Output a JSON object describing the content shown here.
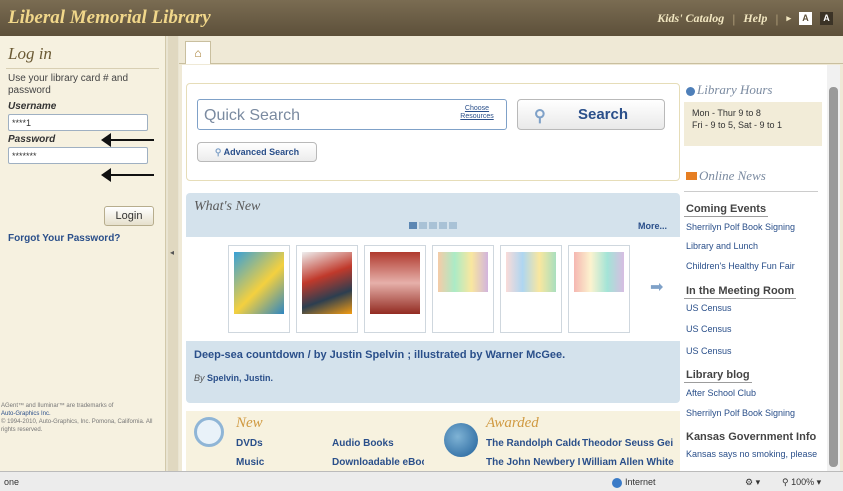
{
  "header": {
    "title": "Liberal Memorial Library",
    "links": [
      "Kids' Catalog",
      "Help"
    ],
    "text_size": [
      "A",
      "A"
    ]
  },
  "login": {
    "heading": "Log in",
    "description": "Use your library card # and password",
    "username_label": "Username",
    "username_value": "****1",
    "password_label": "Password",
    "password_value": "*******",
    "login_button": "Login",
    "forgot": "Forgot Your Password?",
    "footer_1": "AGent™ and Iluminar™ are trademarks of",
    "footer_link": "Auto-Graphics Inc.",
    "footer_2": "© 1994-2010, Auto-Graphics, Inc. Pomona, California. All rights reserved."
  },
  "search": {
    "placeholder": "Quick Search",
    "choose_resources": "Choose Resources",
    "search_button": "Search",
    "advanced_button": "Advanced Search"
  },
  "whats_new": {
    "heading": "What's New",
    "more": "More...",
    "page_count": 5,
    "active_page": 0,
    "caption": "Deep-sea countdown / by Justin Spelvin ; illustrated by Warner McGee.",
    "by_prefix": "By",
    "author": "Spelvin, Justin."
  },
  "lists": {
    "new": {
      "title": "New",
      "items": [
        "DVDs",
        "Audio Books",
        "Music",
        "Downloadable eBoc"
      ]
    },
    "awarded": {
      "title": "Awarded",
      "items": [
        "The Randolph Calde",
        "Theodor Seuss Gei",
        "The John Newbery I",
        "William Allen White"
      ]
    }
  },
  "sidebar": {
    "hours_title": "Library Hours",
    "hours_line1": "Mon - Thur 9 to 8",
    "hours_line2": "Fri - 9 to 5, Sat - 9 to 1",
    "news_title": "Online News",
    "coming_events": "Coming Events",
    "events": [
      "Sherrilyn Polf Book Signing",
      "Library and Lunch",
      "Children's Healthy Fun Fair"
    ],
    "meeting_room": "In the Meeting Room",
    "meetings": [
      "US Census",
      "US Census",
      "US Census"
    ],
    "blog": "Library blog",
    "blog_items": [
      "After School Club",
      "Sherrilyn Polf Book Signing"
    ],
    "kansas": "Kansas Government Info",
    "kansas_item": "Kansas says no smoking, please"
  },
  "statusbar": {
    "left": "one",
    "zone": "Internet",
    "zoom": "100%"
  }
}
